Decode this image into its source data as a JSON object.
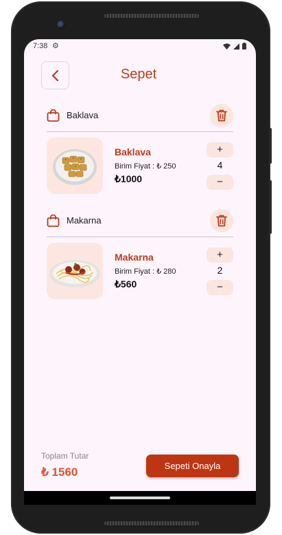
{
  "status_bar": {
    "time": "7:38"
  },
  "header": {
    "title": "Sepet"
  },
  "items": [
    {
      "name": "Baklava",
      "unit_price": "Birim Fiyat : ₺ 250",
      "total": "₺1000",
      "quantity": "4",
      "plus": "+",
      "minus": "−"
    },
    {
      "name": "Makarna",
      "unit_price": "Birim Fiyat : ₺ 280",
      "total": "₺560",
      "quantity": "2",
      "plus": "+",
      "minus": "−"
    }
  ],
  "footer": {
    "total_label": "Toplam Tutar",
    "total_value": "₺ 1560",
    "confirm_label": "Sepeti Onayla"
  },
  "colors": {
    "accent": "#c0391a",
    "button": "#be3511",
    "total": "#e1522e",
    "background": "#fdf5fb",
    "chip": "#fbe5df"
  },
  "icons": {
    "back": "chevron-left-icon",
    "bag": "shopping-bag-icon",
    "trash": "trash-icon"
  }
}
